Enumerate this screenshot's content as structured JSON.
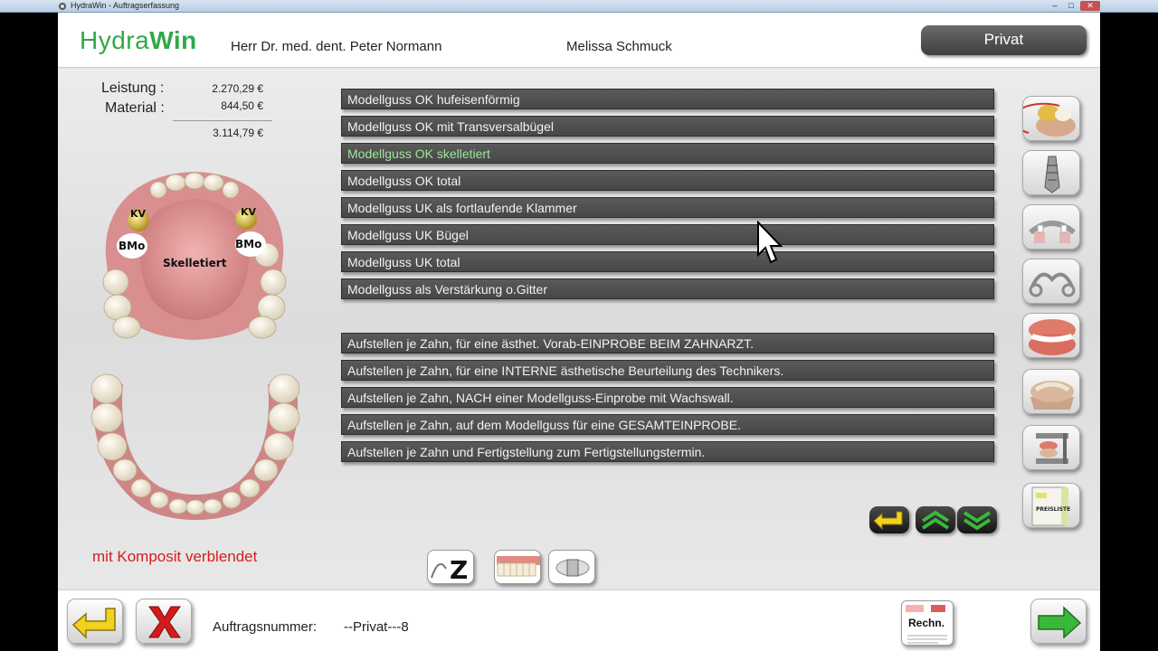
{
  "window": {
    "title": "HydraWin - Auftragserfassung"
  },
  "header": {
    "logo_light": "Hydra",
    "logo_bold": "Win",
    "doctor": "Herr Dr. med. dent. Peter Normann",
    "patient": "Melissa Schmuck",
    "category_button": "Privat"
  },
  "summary": {
    "leistung_label": "Leistung :",
    "leistung_value": "2.270,29 €",
    "material_label": "Material :",
    "material_value": "844,50 €",
    "total_value": "3.114,79 €"
  },
  "diagram": {
    "label_kv_left": "KV",
    "label_kv_right": "KV",
    "label_bmo_left": "BMo",
    "label_bmo_right": "BMo",
    "label_center": "Skelletiert"
  },
  "status_text": "mit Komposit verblendet",
  "modellguss_items": [
    "Modellguss OK hufeisenförmig",
    "Modellguss OK mit Transversalbügel",
    "Modellguss OK skelletiert",
    "Modellguss OK total",
    "Modellguss UK  als fortlaufende Klammer",
    "Modellguss UK Bügel",
    "Modellguss UK total",
    "Modellguss als Verstärkung o.Gitter"
  ],
  "selected_index": 2,
  "aufstellen_items": [
    "Aufstellen je Zahn, für eine ästhet. Vorab-EINPROBE BEIM ZAHNARZT.",
    "Aufstellen je Zahn, für eine INTERNE ästhetische Beurteilung des Technikers.",
    "Aufstellen je Zahn, NACH einer Modellguss-Einprobe mit Wachswall.",
    "Aufstellen je Zahn, auf dem Modellguss für eine GESAMTEINPROBE.",
    "Aufstellen je Zahn und Fertigstellung zum Fertigstellungstermin."
  ],
  "side_icons": [
    "crown-model-icon",
    "implant-abutment-icon",
    "partial-denture-icon",
    "clasp-icon",
    "full-denture-icon",
    "plaster-model-icon",
    "articulator-icon",
    "price-list-icon"
  ],
  "price_list_label": "PREISLISTE",
  "bottom_icons": [
    "attachment-z-icon",
    "tooth-row-icon",
    "connector-icon"
  ],
  "bottom_z_label": "Z",
  "footer": {
    "auftrag_label": "Auftragsnummer:",
    "auftrag_value": "--Privat---8",
    "rechnung_label": "Rechn."
  },
  "colors": {
    "logo_green": "#32a84a",
    "selected_text": "#9fe79a",
    "status_red": "#d21e1e",
    "arrow_yellow": "#f2d21e",
    "arrow_green": "#3ab83a"
  }
}
